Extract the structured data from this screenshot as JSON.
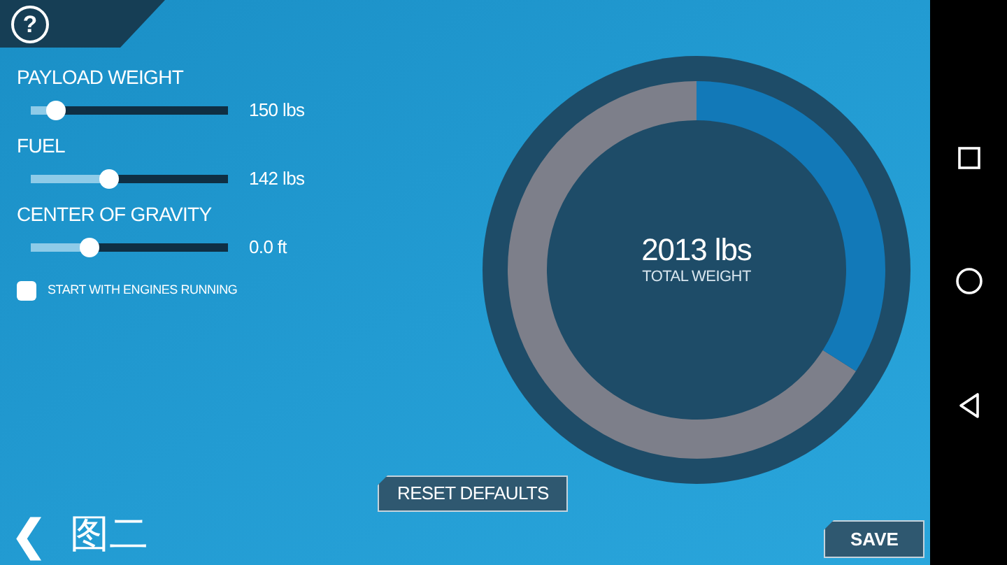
{
  "help_button": {
    "label": "?"
  },
  "sliders": [
    {
      "label": "PAYLOAD WEIGHT",
      "level": 0.13,
      "reading": "150 lbs"
    },
    {
      "label": "FUEL",
      "level": 0.4,
      "reading": "142 lbs"
    },
    {
      "label": "CENTER OF GRAVITY",
      "level": 0.3,
      "reading": "0.0 ft"
    }
  ],
  "engines_option": {
    "label": "START WITH ENGINES RUNNING",
    "checked": false
  },
  "gauge": {
    "value": "2013 lbs",
    "caption": "TOTAL WEIGHT"
  },
  "reset_button": {
    "label": "RESET DEFAULTS"
  },
  "footer": {
    "back": "❮",
    "title": "图二"
  },
  "save_button": {
    "label": "SAVE"
  }
}
